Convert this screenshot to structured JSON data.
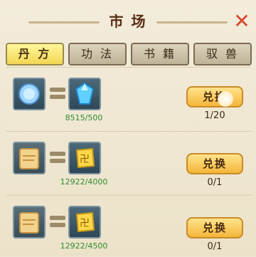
{
  "header": {
    "title": "市 场",
    "close_icon": "close-icon"
  },
  "tabs": [
    {
      "label": "丹 方",
      "active": true
    },
    {
      "label": "功 法",
      "active": false
    },
    {
      "label": "书 籍",
      "active": false
    },
    {
      "label": "驭 兽",
      "active": false
    }
  ],
  "exchanges": [
    {
      "cost_item": "blue-gem-icon",
      "reward_item": "blue-crystal-icon",
      "owned": "8515/500",
      "button": "兑换",
      "progress": "1/20"
    },
    {
      "cost_item": "scroll-icon",
      "reward_item": "gold-token-icon",
      "owned": "12922/4000",
      "button": "兑换",
      "progress": "0/1"
    },
    {
      "cost_item": "scroll-icon",
      "reward_item": "gold-token-icon",
      "owned": "12922/4500",
      "button": "兑换",
      "progress": "0/1"
    }
  ],
  "colors": {
    "accent_green": "#2f8c2f",
    "button_gold": "#f4b63b",
    "close_red": "#d6442a"
  }
}
